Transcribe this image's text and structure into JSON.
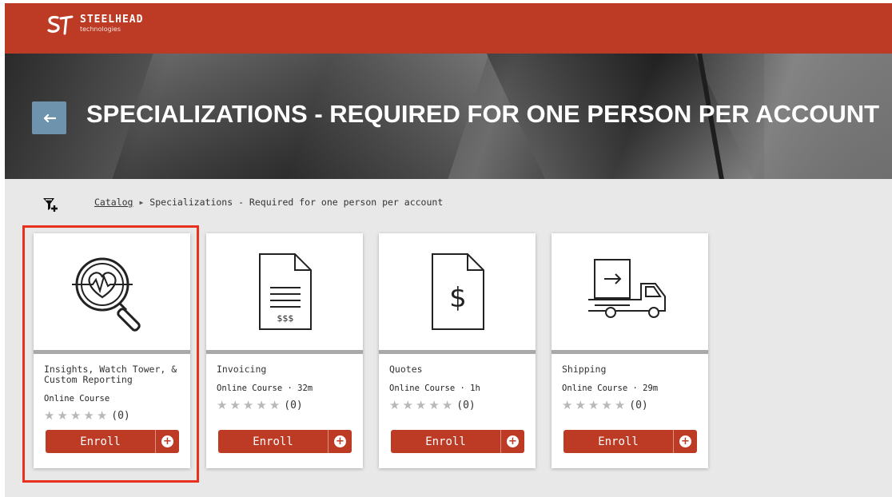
{
  "brand": {
    "name": "STEELHEAD",
    "sub": "technologies",
    "logo_icon": "steelhead-logo-icon"
  },
  "colors": {
    "brand_red": "#bd3b24",
    "back_button": "#6e93ad",
    "highlight": "#e8311f"
  },
  "hero": {
    "title": "SPECIALIZATIONS - REQUIRED FOR ONE PERSON PER ACCOUNT",
    "back_icon": "arrow-left-icon"
  },
  "breadcrumb": {
    "filter_icon": "filter-add-icon",
    "catalog": "Catalog",
    "separator_icon": "caret-right-icon",
    "current": "Specializations - Required for one person per account"
  },
  "courses": [
    {
      "icon": "heart-magnifier-icon",
      "title": "Insights, Watch Tower, & Custom Reporting",
      "meta": "Online Course",
      "rating_count": "(0)",
      "stars": 0,
      "enroll": "Enroll",
      "highlighted": true
    },
    {
      "icon": "invoice-document-icon",
      "title": "Invoicing",
      "meta": "Online Course · 32m",
      "rating_count": "(0)",
      "stars": 0,
      "enroll": "Enroll",
      "highlighted": false
    },
    {
      "icon": "dollar-document-icon",
      "title": "Quotes",
      "meta": "Online Course · 1h",
      "rating_count": "(0)",
      "stars": 0,
      "enroll": "Enroll",
      "highlighted": false
    },
    {
      "icon": "shipping-truck-icon",
      "title": "Shipping",
      "meta": "Online Course · 29m",
      "rating_count": "(0)",
      "stars": 0,
      "enroll": "Enroll",
      "highlighted": false
    }
  ]
}
